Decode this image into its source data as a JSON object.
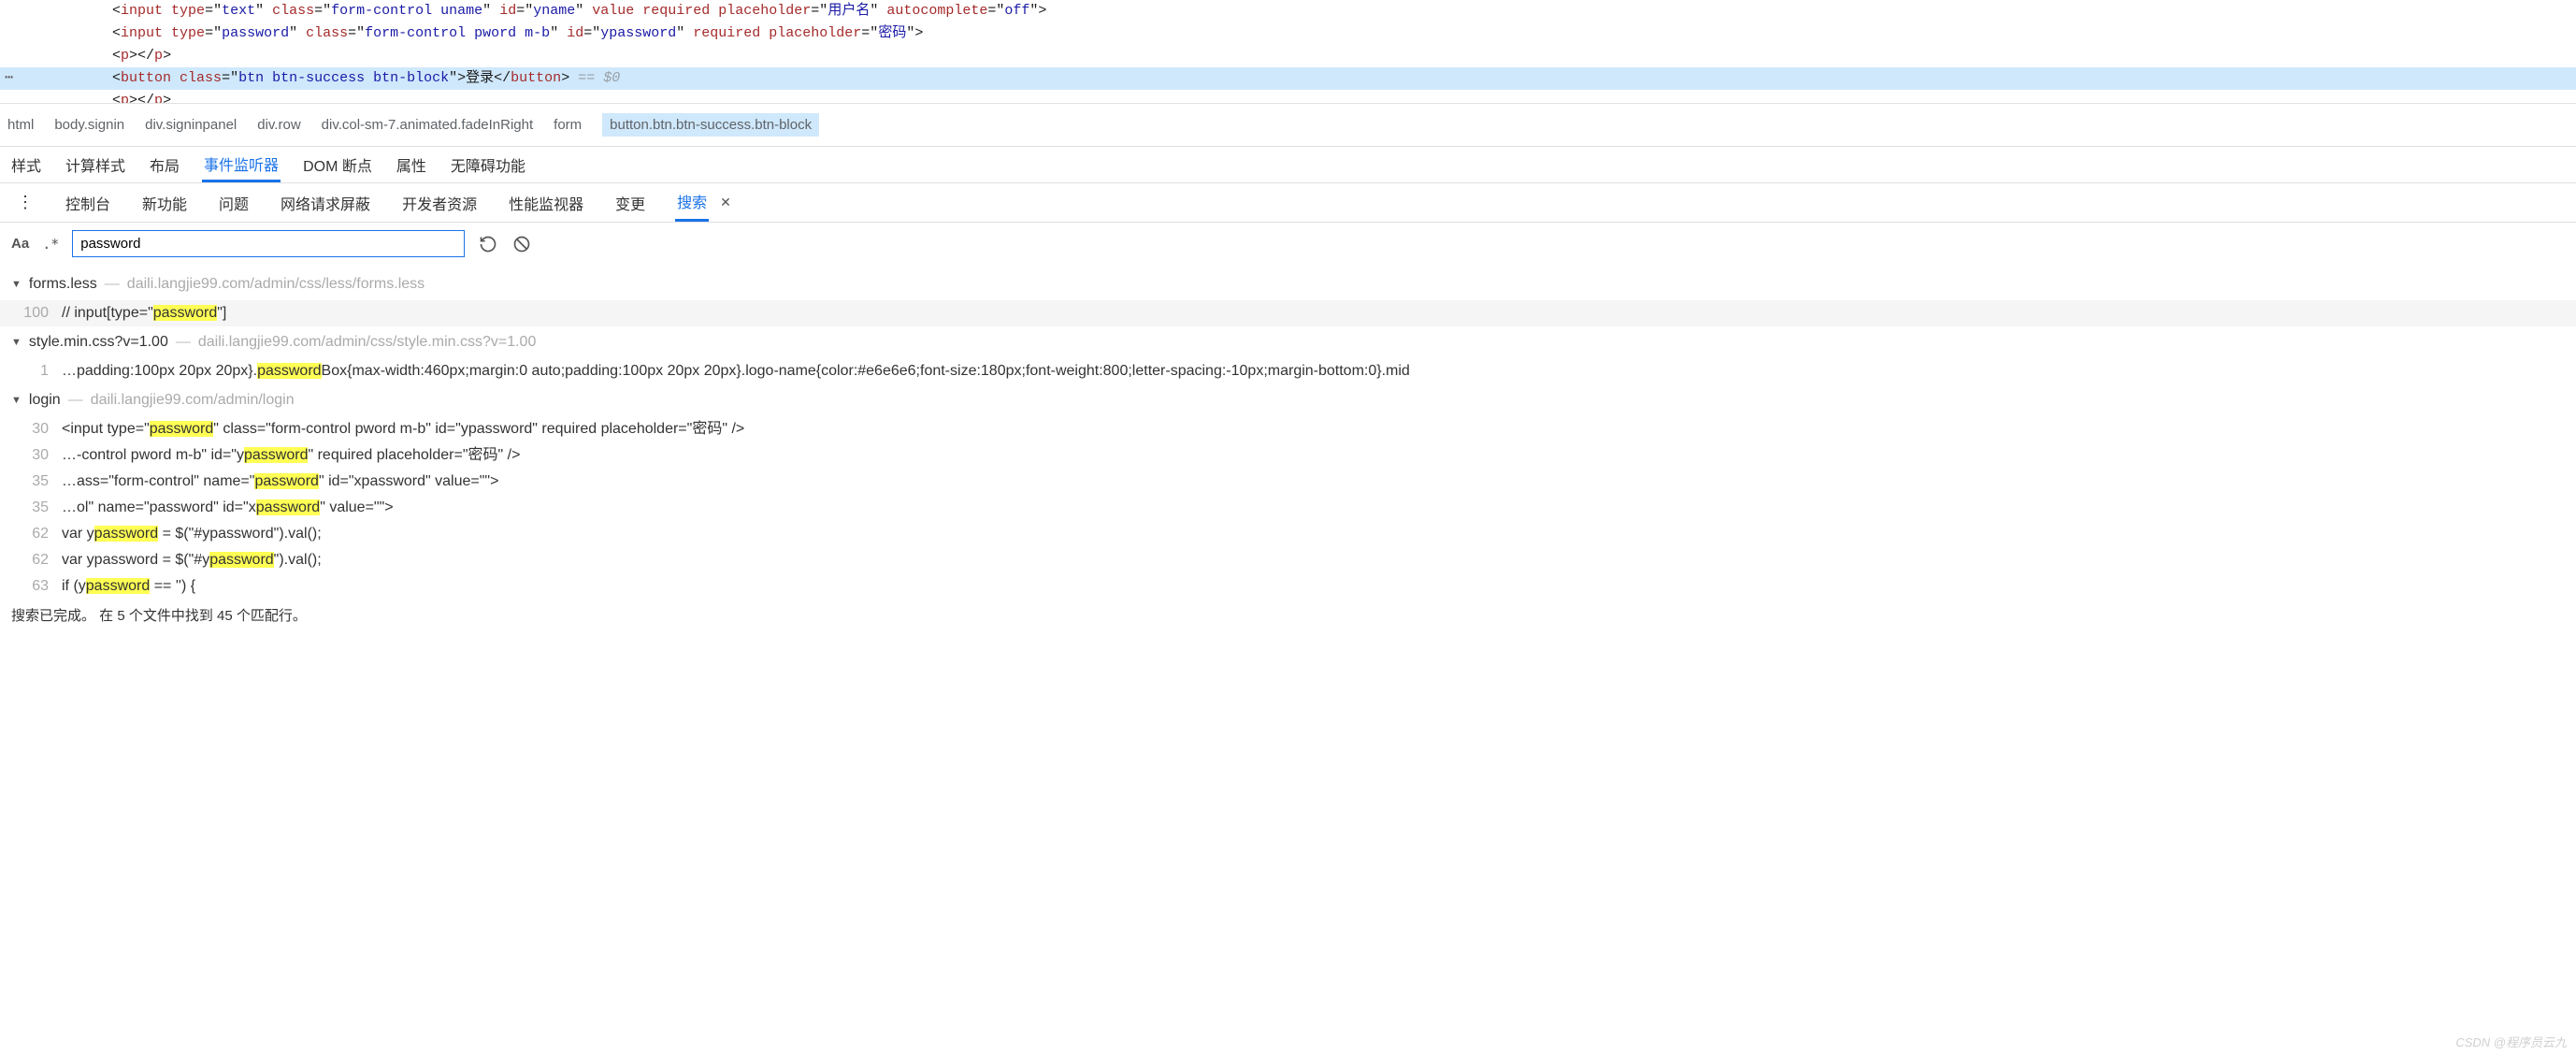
{
  "dom": {
    "lines": [
      {
        "parts": [
          {
            "t": "punct",
            "v": "<"
          },
          {
            "t": "tag",
            "v": "input"
          },
          {
            "t": "punct",
            "v": " "
          },
          {
            "t": "attr",
            "v": "type"
          },
          {
            "t": "punct",
            "v": "=\""
          },
          {
            "t": "val",
            "v": "text"
          },
          {
            "t": "punct",
            "v": "\" "
          },
          {
            "t": "attr",
            "v": "class"
          },
          {
            "t": "punct",
            "v": "=\""
          },
          {
            "t": "val",
            "v": "form-control uname"
          },
          {
            "t": "punct",
            "v": "\" "
          },
          {
            "t": "attr",
            "v": "id"
          },
          {
            "t": "punct",
            "v": "=\""
          },
          {
            "t": "val",
            "v": "yname"
          },
          {
            "t": "punct",
            "v": "\" "
          },
          {
            "t": "attr",
            "v": "value required placeholder"
          },
          {
            "t": "punct",
            "v": "=\""
          },
          {
            "t": "val",
            "v": "用户名"
          },
          {
            "t": "punct",
            "v": "\" "
          },
          {
            "t": "attr",
            "v": "autocomplete"
          },
          {
            "t": "punct",
            "v": "=\""
          },
          {
            "t": "val",
            "v": "off"
          },
          {
            "t": "punct",
            "v": "\">"
          }
        ]
      },
      {
        "parts": [
          {
            "t": "punct",
            "v": "<"
          },
          {
            "t": "tag",
            "v": "input"
          },
          {
            "t": "punct",
            "v": " "
          },
          {
            "t": "attr",
            "v": "type"
          },
          {
            "t": "punct",
            "v": "=\""
          },
          {
            "t": "val",
            "v": "password"
          },
          {
            "t": "punct",
            "v": "\" "
          },
          {
            "t": "attr",
            "v": "class"
          },
          {
            "t": "punct",
            "v": "=\""
          },
          {
            "t": "val",
            "v": "form-control pword m-b"
          },
          {
            "t": "punct",
            "v": "\" "
          },
          {
            "t": "attr",
            "v": "id"
          },
          {
            "t": "punct",
            "v": "=\""
          },
          {
            "t": "val",
            "v": "ypassword"
          },
          {
            "t": "punct",
            "v": "\" "
          },
          {
            "t": "attr",
            "v": "required placeholder"
          },
          {
            "t": "punct",
            "v": "=\""
          },
          {
            "t": "val",
            "v": "密码"
          },
          {
            "t": "punct",
            "v": "\">"
          }
        ]
      },
      {
        "parts": [
          {
            "t": "punct",
            "v": "<"
          },
          {
            "t": "tag",
            "v": "p"
          },
          {
            "t": "punct",
            "v": "></"
          },
          {
            "t": "tag",
            "v": "p"
          },
          {
            "t": "punct",
            "v": ">"
          }
        ]
      },
      {
        "hl": true,
        "dots": "⋯",
        "parts": [
          {
            "t": "punct",
            "v": "<"
          },
          {
            "t": "tag",
            "v": "button"
          },
          {
            "t": "punct",
            "v": " "
          },
          {
            "t": "attr",
            "v": "class"
          },
          {
            "t": "punct",
            "v": "=\""
          },
          {
            "t": "val",
            "v": "btn btn-success btn-block"
          },
          {
            "t": "punct",
            "v": "\">"
          },
          {
            "t": "txt",
            "v": "登录"
          },
          {
            "t": "punct",
            "v": "</"
          },
          {
            "t": "tag",
            "v": "button"
          },
          {
            "t": "punct",
            "v": ">"
          },
          {
            "t": "sel",
            "v": " == $0"
          }
        ]
      },
      {
        "frag": true,
        "parts": [
          {
            "t": "punct",
            "v": "<"
          },
          {
            "t": "tag",
            "v": "p"
          },
          {
            "t": "punct",
            "v": "></"
          },
          {
            "t": "tag",
            "v": "p"
          },
          {
            "t": "punct",
            "v": ">"
          }
        ]
      }
    ]
  },
  "breadcrumb": [
    "html",
    "body.signin",
    "div.signinpanel",
    "div.row",
    "div.col-sm-7.animated.fadeInRight",
    "form",
    "button.btn.btn-success.btn-block"
  ],
  "tabs1": {
    "items": [
      "样式",
      "计算样式",
      "布局",
      "事件监听器",
      "DOM 断点",
      "属性",
      "无障碍功能"
    ],
    "active_index": 3
  },
  "tabs2": {
    "more": "⋮",
    "items": [
      "控制台",
      "新功能",
      "问题",
      "网络请求屏蔽",
      "开发者资源",
      "性能监视器",
      "变更",
      "搜索"
    ],
    "active_index": 7,
    "close": "✕"
  },
  "search": {
    "aa": "Aa",
    "regex": ".*",
    "query": "password"
  },
  "results": [
    {
      "file": "forms.less",
      "path": "daili.langjie99.com/admin/css/less/forms.less",
      "lines": [
        {
          "n": "100",
          "striped": true,
          "segs": [
            {
              "v": "// input[type=\""
            },
            {
              "v": "password",
              "hl": true
            },
            {
              "v": "\"]"
            }
          ]
        }
      ]
    },
    {
      "file": "style.min.css?v=1.00",
      "path": "daili.langjie99.com/admin/css/style.min.css?v=1.00",
      "lines": [
        {
          "n": "1",
          "segs": [
            {
              "v": "…padding:100px 20px 20px}."
            },
            {
              "v": "password",
              "hl": true
            },
            {
              "v": "Box{max-width:460px;margin:0 auto;padding:100px 20px 20px}.logo-name{color:#e6e6e6;font-size:180px;font-weight:800;letter-spacing:-10px;margin-bottom:0}.mid"
            }
          ]
        }
      ]
    },
    {
      "file": "login",
      "path": "daili.langjie99.com/admin/login",
      "lines": [
        {
          "n": "30",
          "segs": [
            {
              "v": "<input type=\""
            },
            {
              "v": "password",
              "hl": true
            },
            {
              "v": "\" class=\"form-control pword m-b\" id=\"ypassword\" required placeholder=\"密码\" />"
            }
          ]
        },
        {
          "n": "30",
          "segs": [
            {
              "v": "…-control pword m-b\" id=\"y"
            },
            {
              "v": "password",
              "hl": true
            },
            {
              "v": "\" required placeholder=\"密码\" />"
            }
          ]
        },
        {
          "n": "35",
          "segs": [
            {
              "v": "…ass=\"form-control\" name=\""
            },
            {
              "v": "password",
              "hl": true
            },
            {
              "v": "\" id=\"xpassword\" value=\"\">"
            }
          ]
        },
        {
          "n": "35",
          "segs": [
            {
              "v": "…ol\" name=\"password\" id=\"x"
            },
            {
              "v": "password",
              "hl": true
            },
            {
              "v": "\" value=\"\">"
            }
          ]
        },
        {
          "n": "62",
          "segs": [
            {
              "v": "var y"
            },
            {
              "v": "password",
              "hl": true
            },
            {
              "v": " = $(\"#ypassword\").val();"
            }
          ]
        },
        {
          "n": "62",
          "segs": [
            {
              "v": "var ypassword = $(\"#y"
            },
            {
              "v": "password",
              "hl": true
            },
            {
              "v": "\").val();"
            }
          ]
        },
        {
          "n": "63",
          "segs": [
            {
              "v": "if (y"
            },
            {
              "v": "password",
              "hl": true
            },
            {
              "v": " == '') {"
            }
          ]
        }
      ]
    }
  ],
  "status": "搜索已完成。 在 5 个文件中找到 45 个匹配行。",
  "watermark": "CSDN @程序员云九"
}
